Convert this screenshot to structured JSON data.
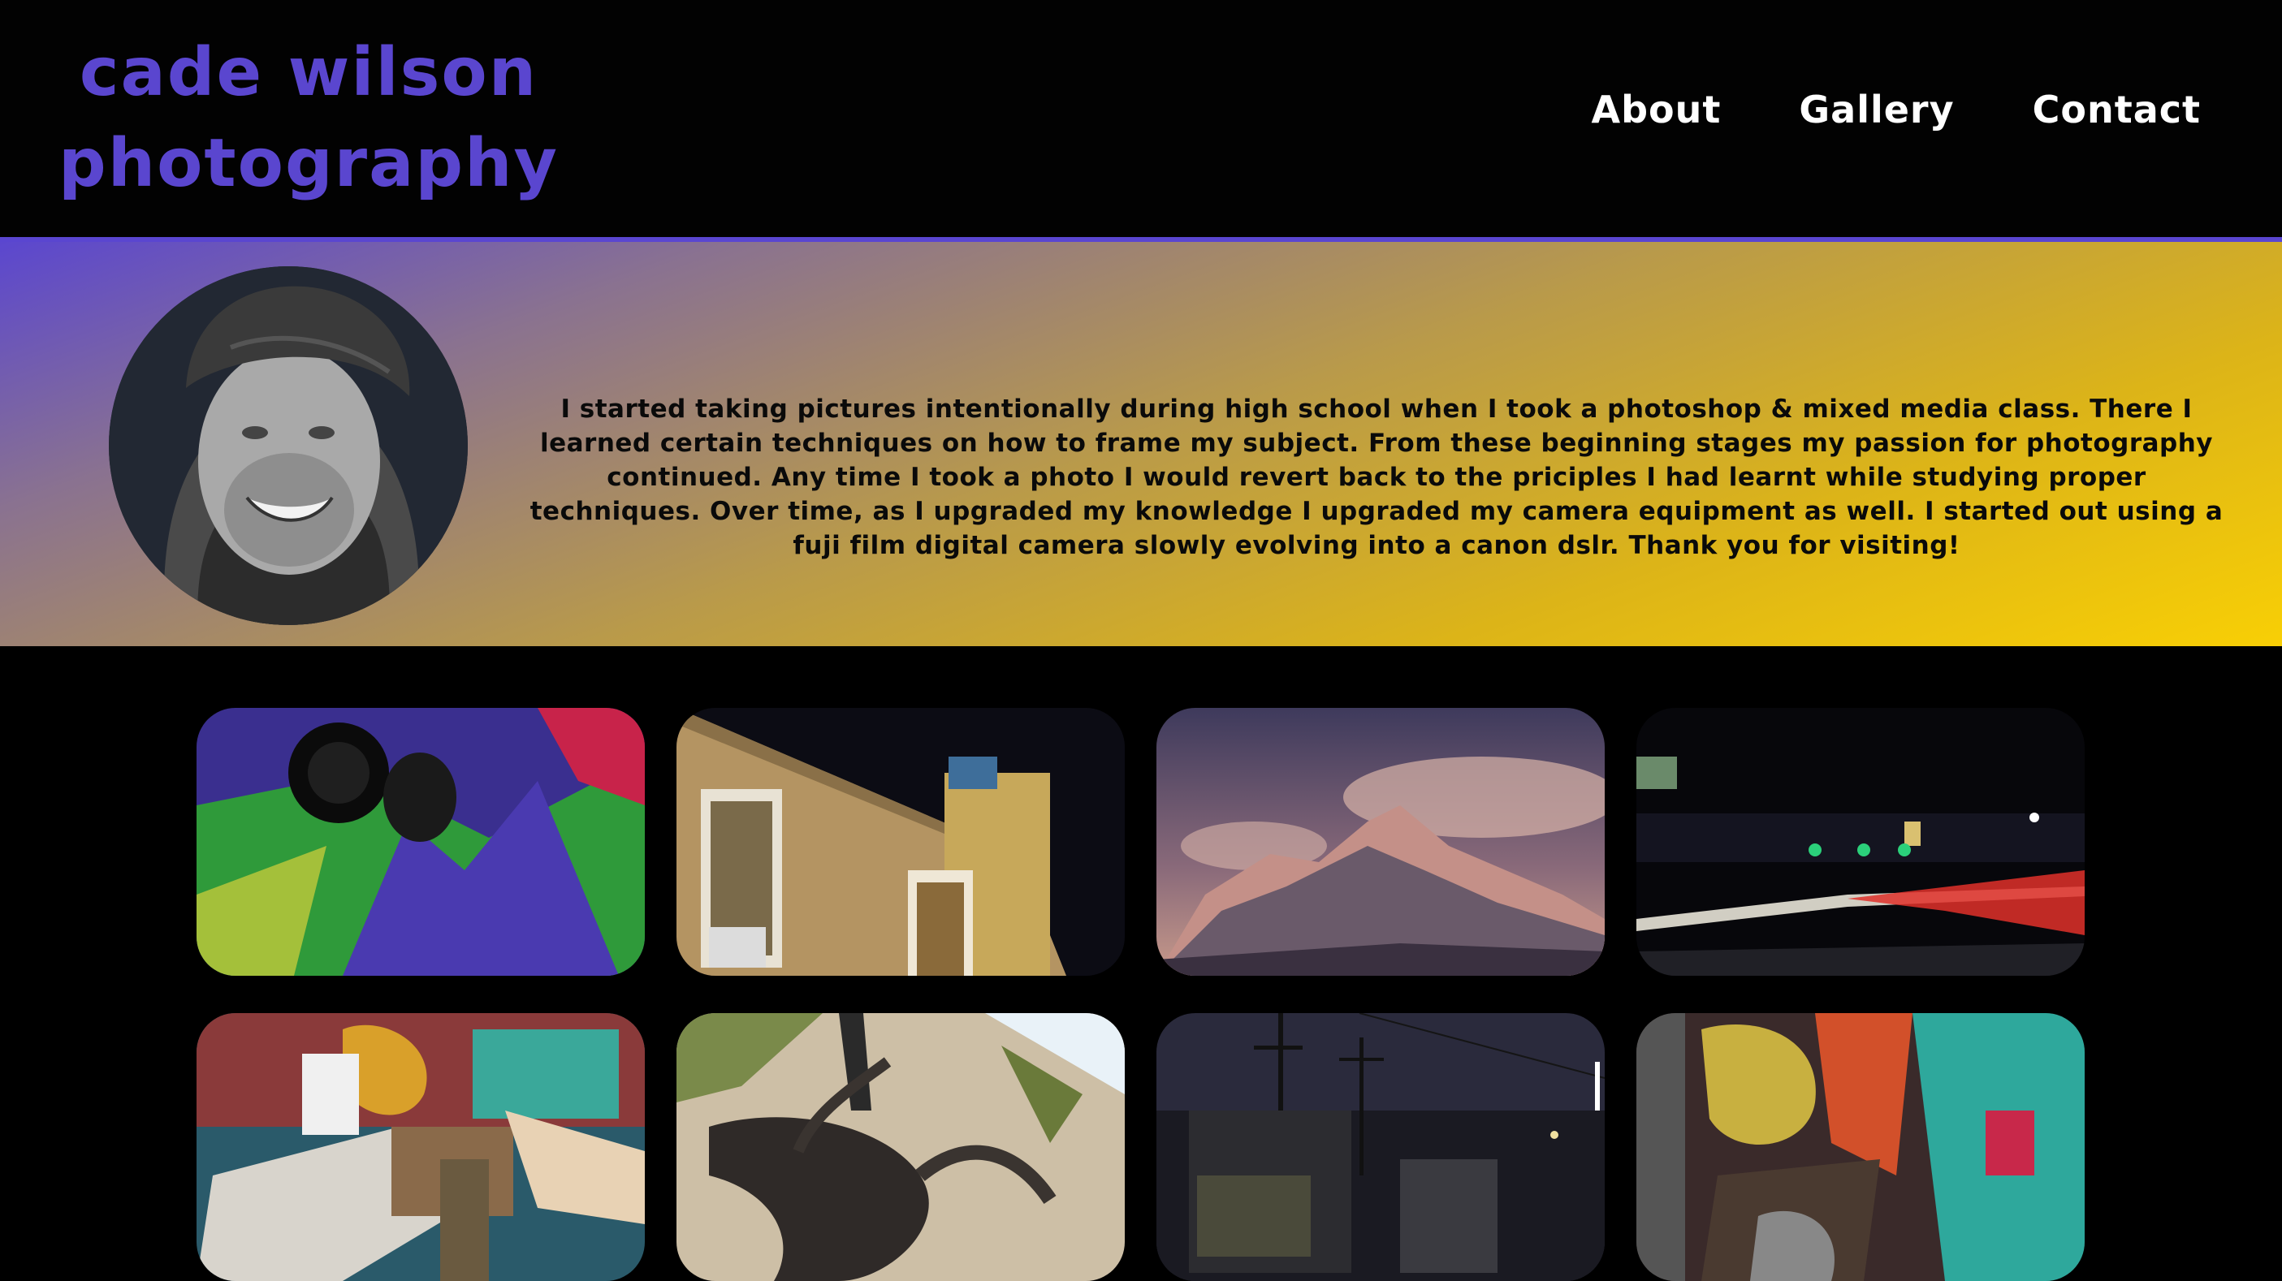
{
  "header": {
    "brand_line1": "cade wilson",
    "brand_line2": "photography",
    "nav": [
      {
        "label": "About"
      },
      {
        "label": "Gallery"
      },
      {
        "label": "Contact"
      }
    ]
  },
  "about": {
    "bio": "I started taking pictures intentionally during high school when I took a photoshop & mixed media class. There I learned certain techniques on how to frame my subject. From these beginning stages my passion for photography continued. Any time I took a photo I would revert back to the priciples I had learnt while studying proper techniques. Over time, as I upgraded my knowledge I upgraded my camera equipment as well. I started out using a fuji film digital camera slowly evolving into a canon dslr. Thank you for visiting!"
  },
  "colors": {
    "brand": "#5a46cf",
    "gradient_start": "#5a46d0",
    "gradient_end": "#f8cf05",
    "background": "#000000"
  }
}
